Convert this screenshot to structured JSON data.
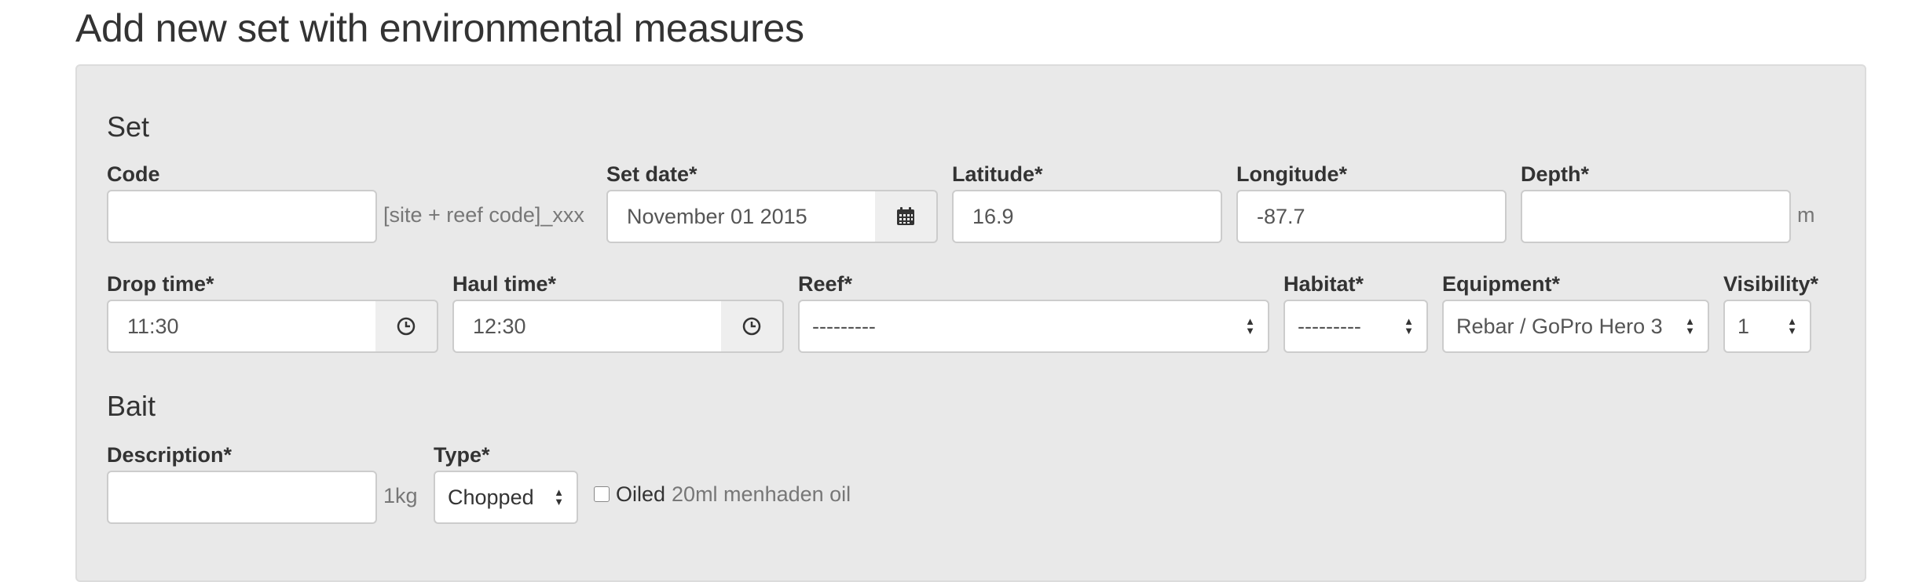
{
  "page": {
    "title": "Add new set with environmental measures"
  },
  "set_section": {
    "heading": "Set",
    "code": {
      "label": "Code",
      "value": "",
      "help": "[site + reef code]_xxx"
    },
    "set_date": {
      "label": "Set date*",
      "value": "November 01 2015",
      "icon": "calendar-icon"
    },
    "latitude": {
      "label": "Latitude*",
      "value": "16.9"
    },
    "longitude": {
      "label": "Longitude*",
      "value": "-87.7"
    },
    "depth": {
      "label": "Depth*",
      "value": "",
      "unit": "m"
    },
    "drop_time": {
      "label": "Drop time*",
      "value": "11:30",
      "icon": "clock-icon"
    },
    "haul_time": {
      "label": "Haul time*",
      "value": "12:30",
      "icon": "clock-icon"
    },
    "reef": {
      "label": "Reef*",
      "selected": "---------"
    },
    "habitat": {
      "label": "Habitat*",
      "selected": "---------"
    },
    "equipment": {
      "label": "Equipment*",
      "selected": "Rebar / GoPro Hero 3"
    },
    "visibility": {
      "label": "Visibility*",
      "selected": "1"
    }
  },
  "bait_section": {
    "heading": "Bait",
    "description": {
      "label": "Description*",
      "value": "",
      "unit": "1kg"
    },
    "type": {
      "label": "Type*",
      "selected": "Chopped"
    },
    "oiled": {
      "label": "Oiled",
      "checked": false,
      "help": "20ml menhaden oil"
    }
  },
  "colors": {
    "panel_bg": "#e9e9e9",
    "input_border": "#cccccc",
    "addon_bg": "#eeeeee",
    "help_text": "#777777"
  }
}
